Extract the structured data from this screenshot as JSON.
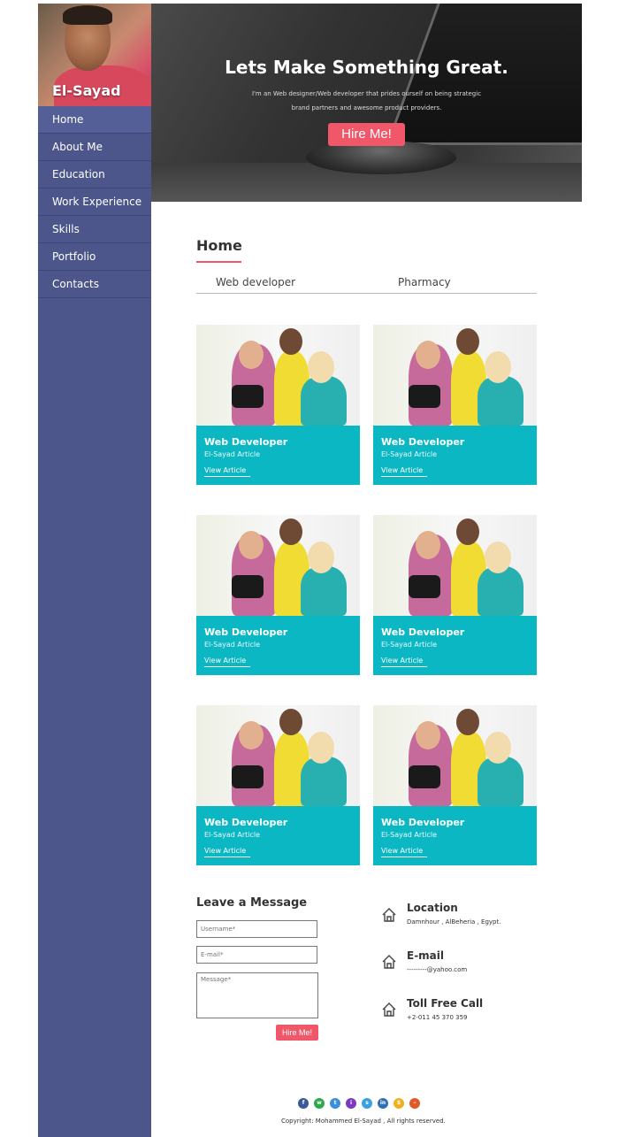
{
  "sidebar": {
    "profile_name": "El-Sayad",
    "items": [
      {
        "label": "Home",
        "active": true
      },
      {
        "label": "About Me"
      },
      {
        "label": "Education"
      },
      {
        "label": "Work Experience"
      },
      {
        "label": "Skills"
      },
      {
        "label": "Portfolio"
      },
      {
        "label": "Contacts"
      }
    ]
  },
  "hero": {
    "title": "Lets Make Something Great.",
    "subtitle": "I'm an Web designer/Web developer that prides ourself on being strategic brand partners and awesome product providers.",
    "button": "Hire Me!"
  },
  "main": {
    "title": "Home",
    "tabs": [
      "Web developer",
      "Pharmacy"
    ],
    "cards": [
      {
        "title": "Web Developer",
        "subtitle": "El-Sayad Article",
        "link": "View Article"
      },
      {
        "title": "Web Developer",
        "subtitle": "El-Sayad Article",
        "link": "View Article"
      },
      {
        "title": "Web Developer",
        "subtitle": "El-Sayad Article",
        "link": "View Article"
      },
      {
        "title": "Web Developer",
        "subtitle": "El-Sayad Article",
        "link": "View Article"
      },
      {
        "title": "Web Developer",
        "subtitle": "El-Sayad Article",
        "link": "View Article"
      },
      {
        "title": "Web Developer",
        "subtitle": "El-Sayad Article",
        "link": "View Article"
      }
    ]
  },
  "contact_form": {
    "title": "Leave a Message",
    "username_placeholder": "Username*",
    "email_placeholder": "E-mail*",
    "message_placeholder": "Message*",
    "button": "Hire Me!"
  },
  "contact_info": [
    {
      "title": "Location",
      "text": "Damnhour , AlBeheria , Egypt.",
      "icon": "home-icon"
    },
    {
      "title": "E-mail",
      "text": "---------@yahoo.com",
      "icon": "home-icon"
    },
    {
      "title": "Toll Free Call",
      "text": "+2-011 45 370 359",
      "icon": "home-icon"
    }
  ],
  "footer": {
    "socials": [
      {
        "icon": "facebook-icon",
        "glyph": "f",
        "color": "#3b5998"
      },
      {
        "icon": "whatsapp-icon",
        "glyph": "w",
        "color": "#2ca94a"
      },
      {
        "icon": "twitter-icon",
        "glyph": "t",
        "color": "#3b8fd8"
      },
      {
        "icon": "instagram-icon",
        "glyph": "i",
        "color": "#7d3ac1"
      },
      {
        "icon": "skype-icon",
        "glyph": "s",
        "color": "#3aa0e0"
      },
      {
        "icon": "linkedin-icon",
        "glyph": "in",
        "color": "#3070b0"
      },
      {
        "icon": "dollar-icon",
        "glyph": "$",
        "color": "#f0b020"
      },
      {
        "icon": "minus-icon",
        "glyph": "–",
        "color": "#e05a28"
      }
    ],
    "copyright": "Copyright: Mohammed El-Sayad , All rights reserved."
  },
  "colors": {
    "sidebar": "#4c568a",
    "accent": "#f0586a",
    "card": "#0cb7c4"
  }
}
